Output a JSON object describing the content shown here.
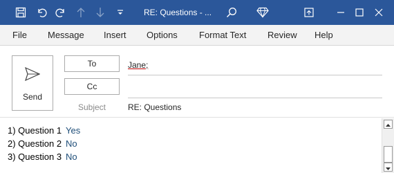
{
  "window": {
    "title": "RE: Questions  - ...",
    "accent_color": "#2b579a"
  },
  "icons": {
    "save": "save-icon",
    "undo": "undo-icon",
    "redo": "redo-icon",
    "up": "arrow-up-icon",
    "down": "arrow-down-icon",
    "customize": "customize-qat-icon",
    "search": "search-icon",
    "diamond": "diamond-icon",
    "ribbon_display": "ribbon-display-icon",
    "minimize": "minimize-icon",
    "maximize": "maximize-icon",
    "close": "close-icon",
    "send": "paper-plane-icon"
  },
  "ribbon": {
    "tabs": [
      "File",
      "Message",
      "Insert",
      "Options",
      "Format Text",
      "Review",
      "Help"
    ]
  },
  "compose": {
    "send_label": "Send",
    "to_label": "To",
    "cc_label": "Cc",
    "subject_label": "Subject",
    "to_value": "Jane;",
    "cc_value": "",
    "subject_value": "RE: Questions"
  },
  "body": {
    "rows": [
      {
        "question": "1) Question 1",
        "answer": "Yes"
      },
      {
        "question": "2) Question 2",
        "answer": "No"
      },
      {
        "question": "3) Question 3",
        "answer": "No"
      }
    ],
    "answer_color": "#1f4e79"
  }
}
